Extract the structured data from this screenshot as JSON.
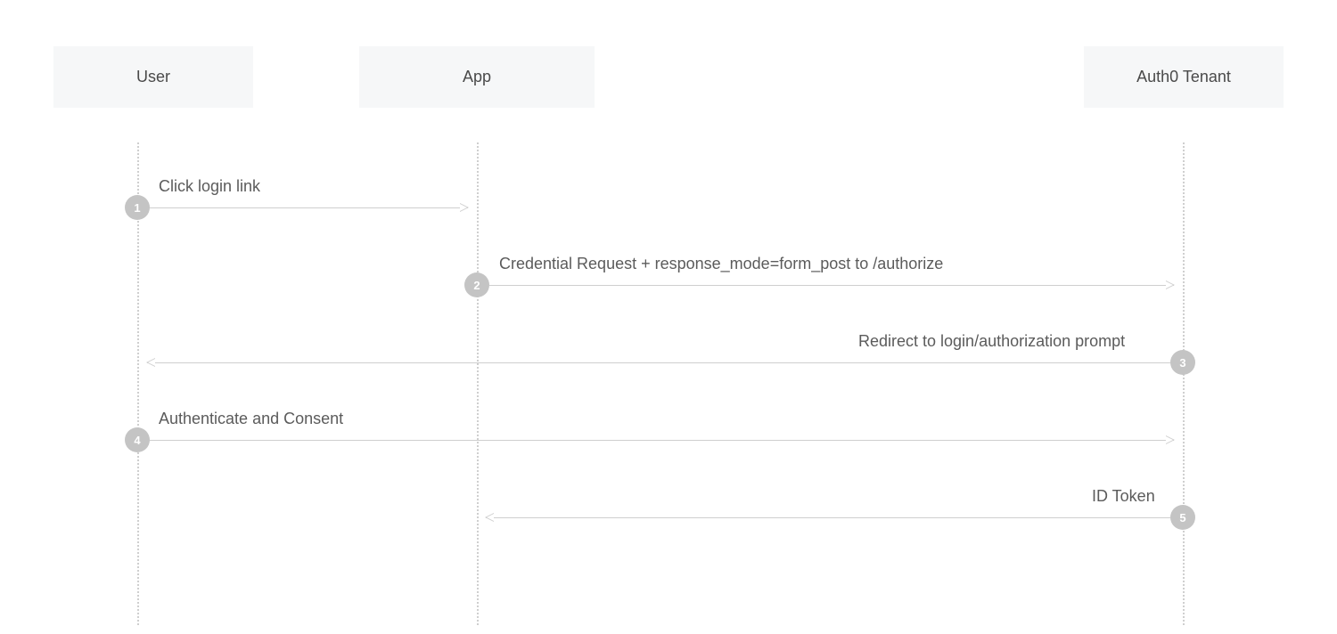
{
  "participants": {
    "user": "User",
    "app": "App",
    "tenant": "Auth0 Tenant"
  },
  "steps": {
    "s1": {
      "num": "1",
      "label": "Click login link"
    },
    "s2": {
      "num": "2",
      "label": "Credential Request + response_mode=form_post to /authorize"
    },
    "s3": {
      "num": "3",
      "label": "Redirect to login/authorization prompt"
    },
    "s4": {
      "num": "4",
      "label": "Authenticate and Consent"
    },
    "s5": {
      "num": "5",
      "label": "ID Token"
    }
  }
}
